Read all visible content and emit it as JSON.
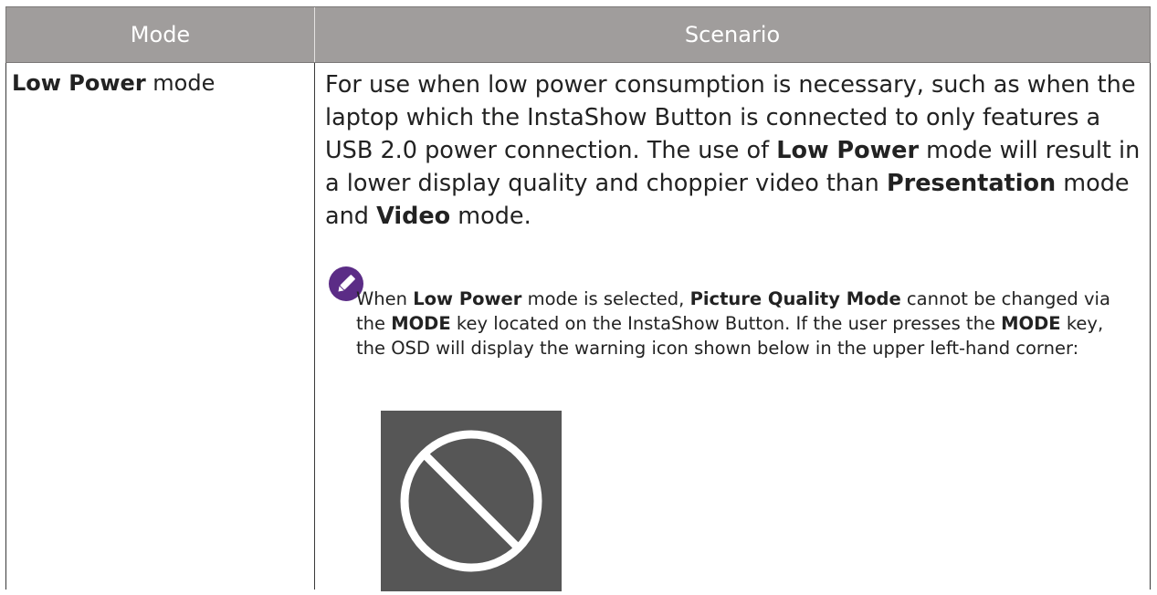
{
  "header": {
    "mode_label": "Mode",
    "scenario_label": "Scenario"
  },
  "row": {
    "mode_bold": "Low Power",
    "mode_rest": " mode",
    "scenario": {
      "p1": "For use when low power consumption is necessary, such as when the laptop which the InstaShow Button is connected to only features a USB 2.0 power connection. The use of ",
      "b1": "Low Power",
      "p2": " mode will result in a lower display quality and choppier video than ",
      "b2": "Presentation",
      "p3": " mode and ",
      "b3": "Video",
      "p4": " mode."
    },
    "note": {
      "t1": "When ",
      "b1": "Low Power",
      "t2": " mode is selected, ",
      "b2": "Picture Quality Mode",
      "t3": " cannot be changed via the ",
      "b3": "MODE",
      "t4": " key located on the InstaShow Button. If the user presses the ",
      "b4": "MODE",
      "t5": " key, the OSD will display the warning icon shown below in the upper left-hand corner:"
    },
    "icons": {
      "note": "pencil-note-icon",
      "warning": "prohibited-warning-icon"
    }
  },
  "colors": {
    "header_bg": "#a09d9c",
    "note_icon_bg": "#5b2c86",
    "warning_bg": "#565656"
  }
}
